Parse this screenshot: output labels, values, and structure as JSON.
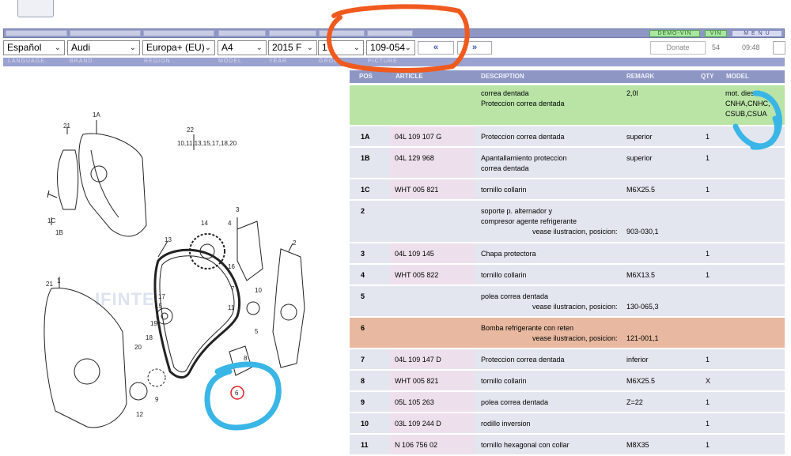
{
  "toolbar": {
    "demo_vin": "DEMO-VIN",
    "vin": "VIN",
    "menu": "M E N U"
  },
  "selectors": {
    "language": "Español",
    "brand": "Audi",
    "region": "Europa+ (EU)",
    "model": "A4",
    "year": "2015 F",
    "group": "1",
    "picture": "109-054",
    "prev": "«",
    "next": "»"
  },
  "status": {
    "donate": "Donate",
    "count": "54",
    "time": "09:48"
  },
  "labels": {
    "language": "LANGUAGE",
    "brand": "BRAND",
    "region": "REGION",
    "model": "MODEL",
    "year": "YEAR",
    "group": "GROU",
    "picture": "PICTURE"
  },
  "table": {
    "headers": {
      "pos": "POS",
      "article": "ARTICLE",
      "description": "DESCRIPTION",
      "remark": "REMARK",
      "qty": "QTY",
      "model": "MODEL"
    },
    "rows": [
      {
        "pos": "",
        "article": "",
        "desc1": "correa dentada",
        "desc2": "Proteccion correa dentada",
        "desc3": "",
        "remark": "2,0l",
        "qty": "",
        "model1": "mot. diesel+",
        "model2": "CNHA,CNHC,",
        "model3": "CSUB,CSUA"
      },
      {
        "pos": "1A",
        "article": "04L 109 107 G",
        "desc1": "Proteccion correa dentada",
        "desc2": "",
        "desc3": "",
        "remark": "superior",
        "qty": "1"
      },
      {
        "pos": "1B",
        "article": "04L 129 968",
        "desc1": "Apantallamiento proteccion",
        "desc2": "correa dentada",
        "desc3": "",
        "remark": "superior",
        "qty": "1"
      },
      {
        "pos": "1C",
        "article": "WHT 005 821",
        "desc1": "tornillo collarin",
        "desc2": "",
        "desc3": "",
        "remark": "M6X25.5",
        "qty": "1"
      },
      {
        "pos": "2",
        "article": "",
        "desc1": "soporte p. alternador y",
        "desc2": "compresor agente refrigerante",
        "desc3": "vease ilustracion, posicion:",
        "remark": "903-030,1",
        "qty": ""
      },
      {
        "pos": "3",
        "article": "04L 109 145",
        "desc1": "Chapa protectora",
        "desc2": "",
        "desc3": "",
        "remark": "",
        "qty": "1"
      },
      {
        "pos": "4",
        "article": "WHT 005 822",
        "desc1": "tornillo collarin",
        "desc2": "",
        "desc3": "",
        "remark": "M6X13.5",
        "qty": "1"
      },
      {
        "pos": "5",
        "article": "",
        "desc1": "polea correa dentada",
        "desc2": "vease ilustracion, posicion:",
        "desc3": "",
        "remark": "130-065,3",
        "qty": ""
      },
      {
        "pos": "6",
        "article": "",
        "desc1": "Bomba refrigerante con reten",
        "desc2": "vease ilustracion, posicion:",
        "desc3": "",
        "remark": "121-001,1",
        "qty": ""
      },
      {
        "pos": "7",
        "article": "04L 109 147 D",
        "desc1": "Proteccion correa dentada",
        "desc2": "",
        "desc3": "",
        "remark": "inferior",
        "qty": "1"
      },
      {
        "pos": "8",
        "article": "WHT 005 821",
        "desc1": "tornillo collarin",
        "desc2": "",
        "desc3": "",
        "remark": "M6X25.5",
        "qty": "X"
      },
      {
        "pos": "9",
        "article": "05L 105 263",
        "desc1": "polea correa dentada",
        "desc2": "",
        "desc3": "",
        "remark": "Z=22",
        "qty": "1"
      },
      {
        "pos": "10",
        "article": "03L 109 244 D",
        "desc1": "rodillo inversion",
        "desc2": "",
        "desc3": "",
        "remark": "",
        "qty": "1"
      },
      {
        "pos": "11",
        "article": "N  106 756 02",
        "desc1": "tornillo hexagonal con collar",
        "desc2": "",
        "desc3": "",
        "remark": "M8X35",
        "qty": "1"
      }
    ]
  },
  "diagram": {
    "callouts": [
      "1A",
      "21",
      "1C",
      "1B",
      "22",
      "10,11,13,15,17,18,20",
      "14",
      "13",
      "3",
      "4",
      "16",
      "2",
      "1",
      "21",
      "17",
      "15",
      "7",
      "10",
      "11",
      "5",
      "19",
      "18",
      "20",
      "8",
      "6",
      "9",
      "12"
    ],
    "watermark": "IFINTE"
  },
  "colors": {
    "highlight_green": "#b9e4a6",
    "highlight_salmon": "#e8b9a0",
    "annotation_orange": "#f05a1e",
    "annotation_blue": "#39b6e6"
  }
}
